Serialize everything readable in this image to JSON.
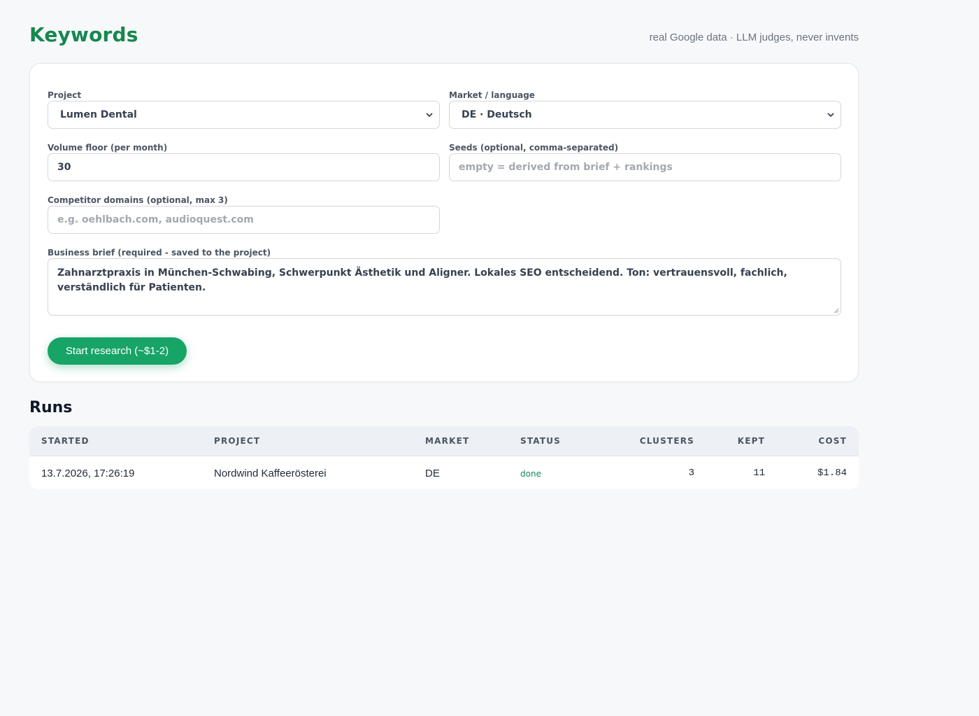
{
  "header": {
    "title": "Keywords",
    "tagline": "real Google data · LLM judges, never invents"
  },
  "form": {
    "project": {
      "label": "Project",
      "value": "Lumen Dental"
    },
    "market": {
      "label": "Market / language",
      "value": "DE · Deutsch"
    },
    "volume_floor": {
      "label": "Volume floor (per month)",
      "value": "30"
    },
    "seeds": {
      "label": "Seeds (optional, comma-separated)",
      "placeholder": "empty = derived from brief + rankings"
    },
    "competitors": {
      "label": "Competitor domains (optional, max 3)",
      "placeholder": "e.g. oehlbach.com, audioquest.com"
    },
    "brief": {
      "label": "Business brief (required - saved to the project)",
      "value": "Zahnarztpraxis in München-Schwabing, Schwerpunkt Ästhetik und Aligner. Lokales SEO entscheidend. Ton: vertrauensvoll, fachlich, verständlich für Patienten."
    },
    "submit_label": "Start research (~$1-2)"
  },
  "runs": {
    "title": "Runs",
    "columns": [
      "STARTED",
      "PROJECT",
      "MARKET",
      "STATUS",
      "CLUSTERS",
      "KEPT",
      "COST"
    ],
    "rows": [
      {
        "started": "13.7.2026, 17:26:19",
        "project": "Nordwind Kaffeerösterei",
        "market": "DE",
        "status": "done",
        "clusters": "3",
        "kept": "11",
        "cost": "$1.84"
      }
    ]
  },
  "colors": {
    "accent": "#16874f",
    "button": "#17a467",
    "background": "#f7f8fa"
  },
  "icons": {
    "select_caret": "chevron-down-icon",
    "textarea_grip": "resize-handle-icon"
  }
}
